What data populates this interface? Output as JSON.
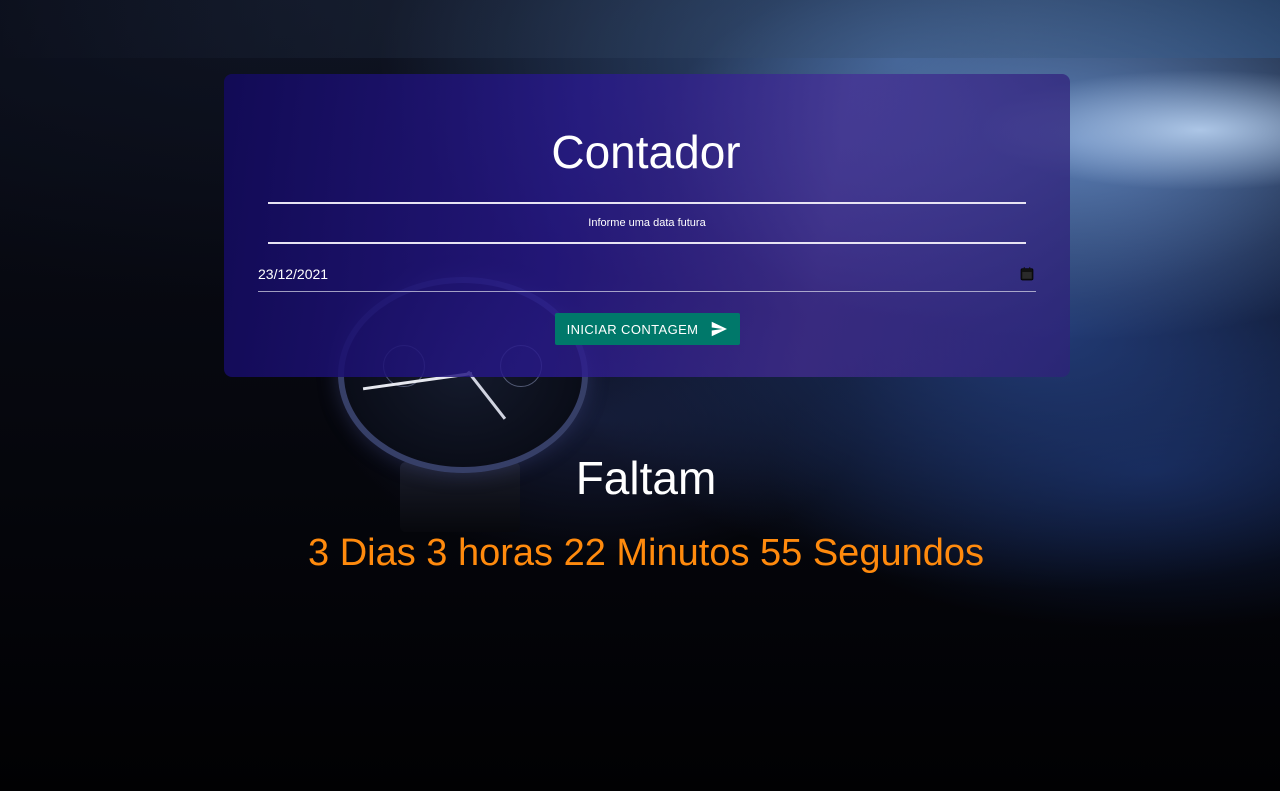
{
  "card": {
    "title": "Contador",
    "hint": "Informe uma data futura",
    "date_value": "23/12/2021",
    "start_button_label": "INICIAR CONTAGEM"
  },
  "result": {
    "heading": "Faltam",
    "countdown": "3 Dias 3 horas 22 Minutos 55 Segundos"
  },
  "icons": {
    "calendar": "calendar-icon",
    "send": "send-icon"
  },
  "colors": {
    "card_bg": "#1c1273",
    "button_bg": "#00786a",
    "countdown_text": "#ff8a0d",
    "title_text": "#ffffff"
  }
}
